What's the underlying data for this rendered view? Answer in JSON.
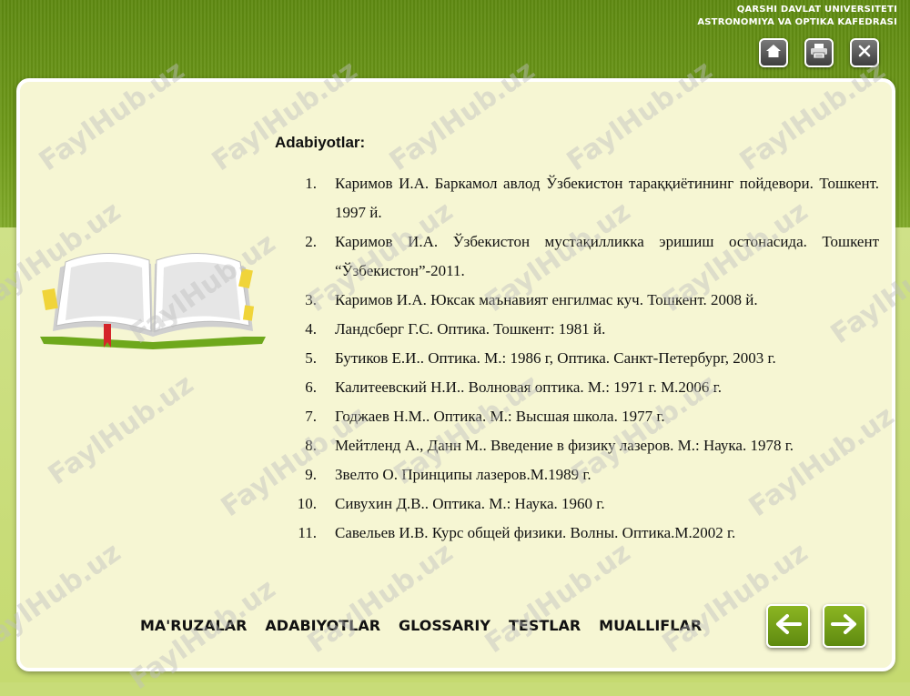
{
  "header": {
    "line1": "QARSHI DAVLAT UNIVERSITETI",
    "line2": "ASTRONOMIYA VA OPTIKA KAFEDRASI"
  },
  "toolbar": {
    "home_icon": "home-icon",
    "print_icon": "printer-icon",
    "close_icon": "close-icon"
  },
  "main": {
    "heading": "Adabiyotlar:",
    "references": [
      {
        "num": "1.",
        "text": "Каримов И.А. Баркамол авлод Ўзбекистон тараққиётининг пойдевори. Тошкент. 1997 й."
      },
      {
        "num": "2.",
        "text": "Каримов И.А. Ўзбекистон мустақилликка эришиш остонасида. Тошкент “Ўзбекистон”-2011."
      },
      {
        "num": "3.",
        "text": "Каримов И.А. Юксак маънавият енгилмас куч. Тошкент. 2008 й."
      },
      {
        "num": "4.",
        "text": "Ландсберг Г.С. Оптика. Тошкент: 1981 й."
      },
      {
        "num": "5.",
        "text": "Бутиков Е.И.. Оптика. М.: 1986 г, Оптика. Санкт-Петербург, 2003 г."
      },
      {
        "num": "6.",
        "text": "Калитеевский Н.И.. Волновая оптика. М.: 1971 г. М.2006 г."
      },
      {
        "num": "7.",
        "text": "Годжаев Н.М.. Оптика. М.: Высшая школа. 1977 г."
      },
      {
        "num": "8.",
        "text": "Мейтленд А., Данн М.. Введение в физику лазеров. М.: Наука. 1978 г."
      },
      {
        "num": "9.",
        "text": "Звелто О. Принципы лазеров.М.1989 г."
      },
      {
        "num": "10.",
        "text": "Сивухин Д.В.. Оптика. М.: Наука. 1960 г."
      },
      {
        "num": "11.",
        "text": "Савельев И.В. Курс общей физики. Волны. Оптика.М.2002 г."
      }
    ]
  },
  "nav": {
    "items": [
      "MA'RUZALAR",
      "ADABIYOTLAR",
      "GLOSSARIY",
      "TESTLAR",
      "MUALLIFLAR"
    ],
    "prev_icon": "arrow-left-icon",
    "next_icon": "arrow-right-icon"
  },
  "watermark": "FaylHub.uz",
  "colors": {
    "header_green": "#6f9a1a",
    "panel_bg": "#f6f6d3",
    "arrow_green": "#7aa41a"
  }
}
